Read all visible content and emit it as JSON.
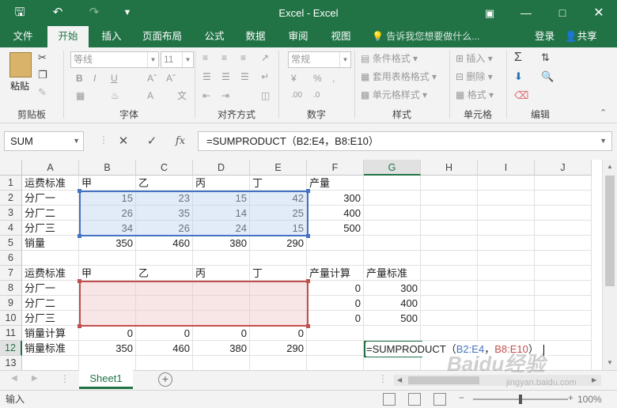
{
  "titlebar": {
    "title": "Excel - Excel",
    "save_icon": "save-icon",
    "undo_icon": "undo-icon",
    "redo_icon": "redo-icon",
    "customize_icon": "customize-icon"
  },
  "tabs": [
    "文件",
    "开始",
    "插入",
    "页面布局",
    "公式",
    "数据",
    "审阅",
    "视图"
  ],
  "tell_me": "告诉我您想要做什么...",
  "login": "登录",
  "share": "共享",
  "ribbon": {
    "paste": "粘贴",
    "font_name": "等线",
    "font_size": "11",
    "number_format": "常规",
    "conditional_format": "条件格式",
    "table_format": "套用表格格式",
    "cell_style": "单元格样式",
    "insert": "插入",
    "delete": "删除",
    "format": "格式",
    "groups": [
      "剪贴板",
      "字体",
      "对齐方式",
      "数字",
      "样式",
      "单元格",
      "编辑"
    ]
  },
  "formula_bar": {
    "name_box": "SUM",
    "formula": "=SUMPRODUCT（B2:E4，B8:E10）"
  },
  "columns": [
    "A",
    "B",
    "C",
    "D",
    "E",
    "F",
    "G",
    "H",
    "I",
    "J"
  ],
  "rows": [
    "1",
    "2",
    "3",
    "4",
    "5",
    "6",
    "7",
    "8",
    "9",
    "10",
    "11",
    "12",
    "13"
  ],
  "cells": {
    "A1": "运费标准",
    "B1": "甲",
    "C1": "乙",
    "D1": "丙",
    "E1": "丁",
    "F1": "产量",
    "A2": "分厂一",
    "B2": "15",
    "C2": "23",
    "D2": "15",
    "E2": "42",
    "F2": "300",
    "A3": "分厂二",
    "B3": "26",
    "C3": "35",
    "D3": "14",
    "E3": "25",
    "F3": "400",
    "A4": "分厂三",
    "B4": "34",
    "C4": "26",
    "D4": "24",
    "E4": "15",
    "F4": "500",
    "A5": "销量",
    "B5": "350",
    "C5": "460",
    "D5": "380",
    "E5": "290",
    "A7": "运费标准",
    "B7": "甲",
    "C7": "乙",
    "D7": "丙",
    "E7": "丁",
    "F7": "产量计算",
    "G7": "产量标准",
    "A8": "分厂一",
    "F8": "0",
    "G8": "300",
    "A9": "分厂二",
    "F9": "0",
    "G9": "400",
    "A10": "分厂三",
    "F10": "0",
    "G10": "500",
    "A11": "销量计算",
    "B11": "0",
    "C11": "0",
    "D11": "0",
    "E11": "0",
    "A12": "销量标准",
    "B12": "350",
    "C12": "460",
    "D12": "380",
    "E12": "290"
  },
  "editing": {
    "prefix": "=SUMPRODUCT（",
    "ref1": "B2:E4",
    "sep": "，",
    "ref2": "B8:E10",
    "suffix": "）"
  },
  "sheet": "Sheet1",
  "status": {
    "mode": "输入",
    "zoom": "100%"
  },
  "watermark": {
    "logo": "Baidu经验",
    "url": "jingyan.baidu.com"
  },
  "colors": {
    "accent": "#217346",
    "ref1": "#4472c4",
    "ref2": "#c0504d"
  }
}
